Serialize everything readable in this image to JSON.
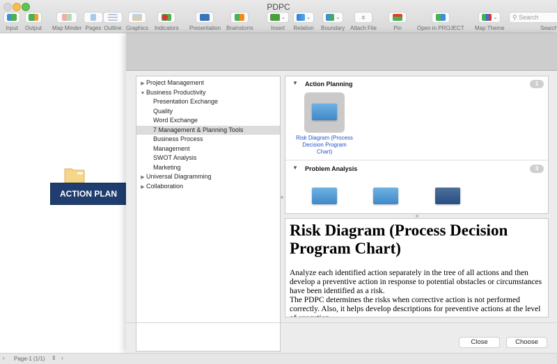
{
  "window": {
    "title": "PDPC"
  },
  "toolbar": {
    "items": [
      {
        "label": "Input",
        "icon": "input-icon"
      },
      {
        "label": "Output",
        "icon": "output-icon"
      },
      {
        "label": "Map Minder",
        "icon": "map-minder-icon"
      },
      {
        "label": "Pages",
        "icon": "pages-icon"
      },
      {
        "label": "Outline",
        "icon": "outline-icon"
      },
      {
        "label": "Graphics",
        "icon": "graphics-icon"
      },
      {
        "label": "Indicators",
        "icon": "indicators-icon"
      },
      {
        "label": "Presentation",
        "icon": "presentation-icon"
      },
      {
        "label": "Brainstorm",
        "icon": "brainstorm-icon"
      },
      {
        "label": "Insert",
        "icon": "insert-icon"
      },
      {
        "label": "Relation",
        "icon": "relation-icon"
      },
      {
        "label": "Boundary",
        "icon": "boundary-icon"
      },
      {
        "label": "Attach File",
        "icon": "paperclip-icon"
      },
      {
        "label": "Pin",
        "icon": "pin-icon"
      },
      {
        "label": "Open in PROJECT",
        "icon": "project-icon"
      },
      {
        "label": "Map Theme",
        "icon": "map-theme-icon"
      }
    ],
    "search": {
      "placeholder": "Search",
      "label": "Search"
    }
  },
  "canvas": {
    "node_label": "ACTION PLAN"
  },
  "statusbar": {
    "page": "Page-1 (1/1)"
  },
  "dialog": {
    "tree": [
      {
        "label": "Project Management",
        "level": 0,
        "state": "collapsed"
      },
      {
        "label": "Business Productivity",
        "level": 0,
        "state": "expanded"
      },
      {
        "label": "Presentation Exchange",
        "level": 1
      },
      {
        "label": "Quality",
        "level": 1
      },
      {
        "label": "Word Exchange",
        "level": 1
      },
      {
        "label": "7 Management & Planning Tools",
        "level": 1,
        "selected": true
      },
      {
        "label": "Business Process",
        "level": 1
      },
      {
        "label": "Management",
        "level": 1
      },
      {
        "label": "SWOT Analysis",
        "level": 1
      },
      {
        "label": "Marketing",
        "level": 1
      },
      {
        "label": "Universal Diagramming",
        "level": 0,
        "state": "collapsed"
      },
      {
        "label": "Collaboration",
        "level": 0,
        "state": "collapsed"
      }
    ],
    "sections": [
      {
        "title": "Action Planning",
        "count": "1",
        "templates": [
          "Risk Diagram (Process Decision Program Chart)"
        ]
      },
      {
        "title": "Problem Analysis",
        "count": "3"
      }
    ],
    "description": {
      "title": "Risk Diagram (Process Decision Program Chart)",
      "p1": "Analyze each identified action separately in the tree of all actions and then develop a preventive action in response to potential obstacles or circumstances have been identified as a risk.",
      "p2": "The PDPC determines the risks when corrective action is not performed correctly. Also, it helps develop descriptions for preventive actions at the level of execution."
    },
    "buttons": {
      "close": "Close",
      "choose": "Choose"
    }
  }
}
